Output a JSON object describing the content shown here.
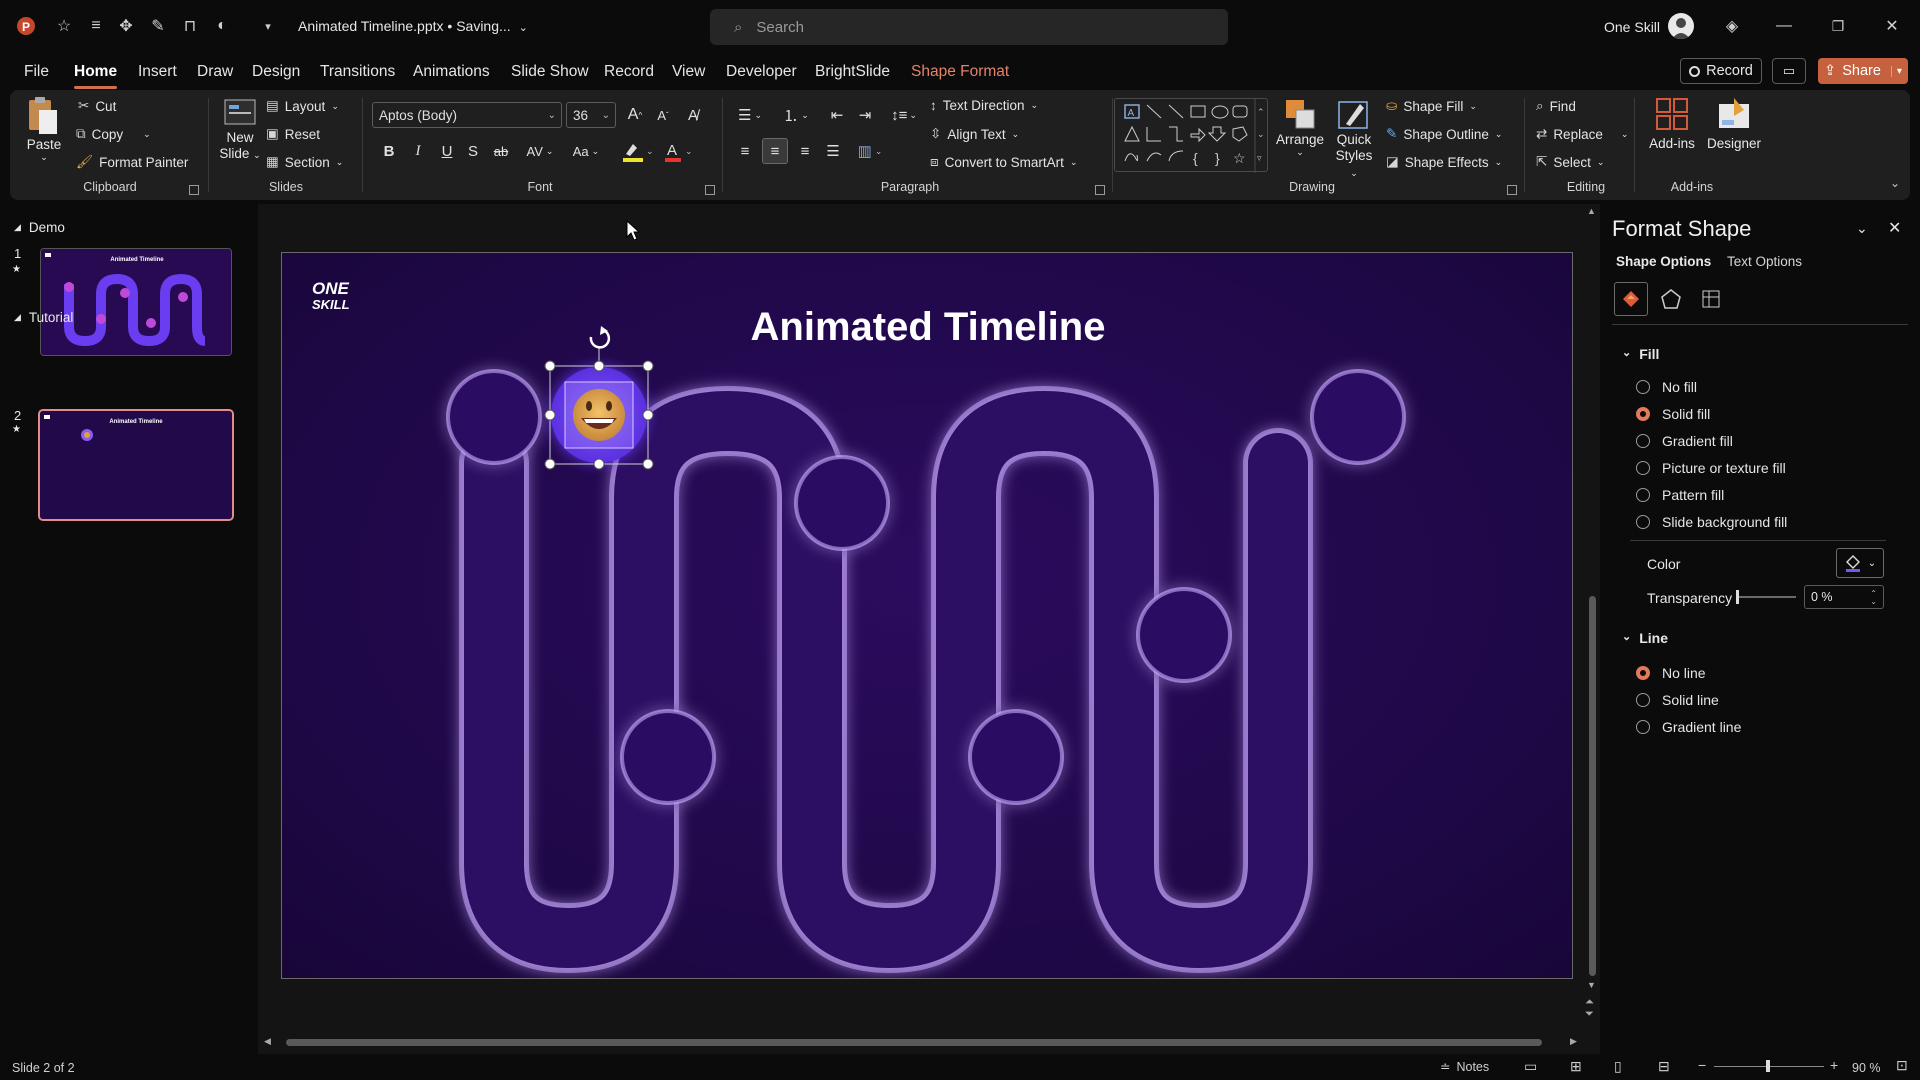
{
  "titlebar": {
    "doc_title": "Animated Timeline.pptx • Saving...",
    "search_placeholder": "Search",
    "user_name": "One Skill"
  },
  "tabs": [
    "File",
    "Home",
    "Insert",
    "Draw",
    "Design",
    "Transitions",
    "Animations",
    "Slide Show",
    "Record",
    "View",
    "Developer",
    "BrightSlide",
    "Shape Format"
  ],
  "tab_actions": {
    "record": "Record",
    "share": "Share"
  },
  "ribbon": {
    "clipboard": {
      "paste": "Paste",
      "cut": "Cut",
      "copy": "Copy",
      "format_painter": "Format Painter",
      "label": "Clipboard"
    },
    "slides": {
      "new_slide_1": "New",
      "new_slide_2": "Slide",
      "layout": "Layout",
      "reset": "Reset",
      "section": "Section",
      "label": "Slides"
    },
    "font": {
      "name": "Aptos (Body)",
      "size": "36",
      "label": "Font"
    },
    "paragraph": {
      "text_direction": "Text Direction",
      "align_text": "Align Text",
      "smartart": "Convert to SmartArt",
      "label": "Paragraph"
    },
    "drawing": {
      "arrange": "Arrange",
      "quick_styles_1": "Quick",
      "quick_styles_2": "Styles",
      "shape_fill": "Shape Fill",
      "shape_outline": "Shape Outline",
      "shape_effects": "Shape Effects",
      "label": "Drawing"
    },
    "editing": {
      "find": "Find",
      "replace": "Replace",
      "select": "Select",
      "label": "Editing"
    },
    "addins": {
      "addins": "Add-ins",
      "designer": "Designer",
      "label": "Add-ins"
    }
  },
  "left_pane": {
    "sections": [
      {
        "name": "Demo",
        "slide_number": "1",
        "thumb_title": "Animated Timeline"
      },
      {
        "name": "Tutorial",
        "slide_number": "2",
        "thumb_title": "Animated Timeline"
      }
    ]
  },
  "slide": {
    "logo_line1": "ONE",
    "logo_line2": "SKILL",
    "title": "Animated Timeline"
  },
  "format_pane": {
    "title": "Format Shape",
    "tabs": [
      "Shape Options",
      "Text Options"
    ],
    "fill_header": "Fill",
    "fill_options": [
      "No fill",
      "Solid fill",
      "Gradient fill",
      "Picture or texture fill",
      "Pattern fill",
      "Slide background fill"
    ],
    "fill_selected": "Solid fill",
    "color_label": "Color",
    "transparency_label": "Transparency",
    "transparency_value": "0 %",
    "line_header": "Line",
    "line_options": [
      "No line",
      "Solid line",
      "Gradient line"
    ],
    "line_selected": "No line"
  },
  "status": {
    "slide_info": "Slide 2 of 2",
    "notes": "Notes",
    "zoom": "90 %"
  },
  "colors": {
    "accent": "#d0704d",
    "slide_bg": "#1e0846",
    "track": "#2a0f5c",
    "share_btn": "#c5613e"
  }
}
